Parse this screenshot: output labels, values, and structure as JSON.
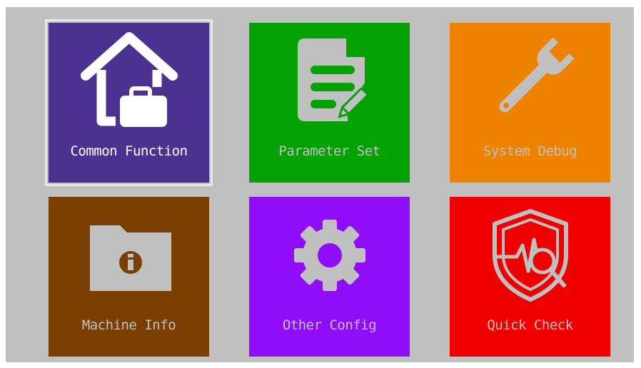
{
  "tiles": [
    {
      "id": "common-function",
      "label": "Common Function",
      "icon": "home-briefcase-icon",
      "bg": "#4b3290",
      "fg": "#ffffff",
      "selected": true
    },
    {
      "id": "parameter-set",
      "label": "Parameter Set",
      "icon": "document-edit-icon",
      "bg": "#05a205",
      "fg": "#c0c0c0",
      "selected": false
    },
    {
      "id": "system-debug",
      "label": "System Debug",
      "icon": "wrench-icon",
      "bg": "#ee8200",
      "fg": "#c0c0c0",
      "selected": false
    },
    {
      "id": "machine-info",
      "label": "Machine Info",
      "icon": "folder-info-icon",
      "bg": "#7a3e00",
      "fg": "#c0c0c0",
      "selected": false
    },
    {
      "id": "other-config",
      "label": "Other Config",
      "icon": "gear-icon",
      "bg": "#8f0df8",
      "fg": "#c0c0c0",
      "selected": false
    },
    {
      "id": "quick-check",
      "label": "Quick Check",
      "icon": "shield-pulse-search-icon",
      "bg": "#f00000",
      "fg": "#c0c0c0",
      "selected": false
    }
  ]
}
